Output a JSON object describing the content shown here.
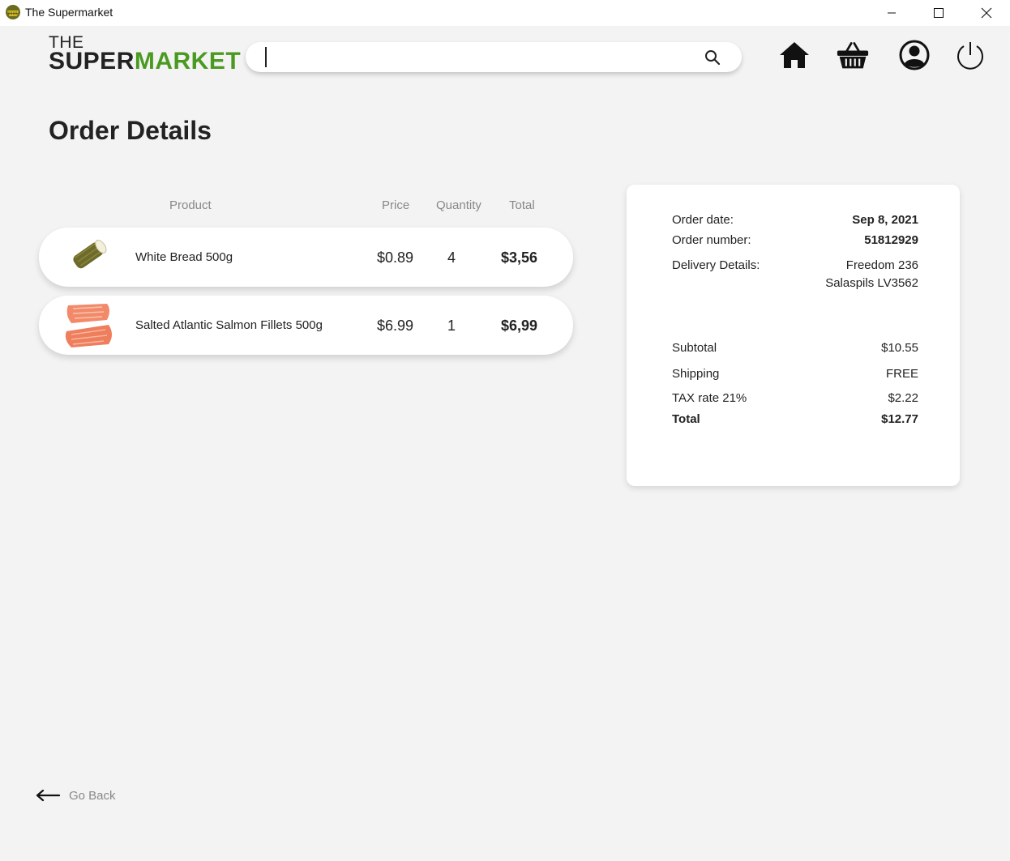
{
  "window": {
    "title": "The Supermarket",
    "icon": "basket-globe-icon"
  },
  "logo": {
    "the": "THE",
    "super": "SUPER",
    "market": "MARKET",
    "accent_color": "#4a9a21"
  },
  "search": {
    "value": "",
    "placeholder": ""
  },
  "nav": {
    "icons": [
      "home-icon",
      "basket-icon",
      "account-icon",
      "power-icon"
    ]
  },
  "page": {
    "title": "Order Details"
  },
  "table": {
    "headers": {
      "product": "Product",
      "price": "Price",
      "quantity": "Quantity",
      "total": "Total"
    },
    "items": [
      {
        "name": "White Bread 500g",
        "price": "$0.89",
        "quantity": "4",
        "total": "$3,56",
        "image": "bread-image"
      },
      {
        "name": "Salted Atlantic Salmon Fillets 500g",
        "price": "$6.99",
        "quantity": "1",
        "total": "$6,99",
        "image": "salmon-image"
      }
    ]
  },
  "summary": {
    "order_date_label": "Order date:",
    "order_date": "Sep 8, 2021",
    "order_number_label": "Order number:",
    "order_number": "51812929",
    "delivery_label": "Delivery Details:",
    "delivery_line1": "Freedom 236",
    "delivery_line2": "Salaspils LV3562",
    "subtotal_label": "Subtotal",
    "subtotal": "$10.55",
    "shipping_label": "Shipping",
    "shipping": "FREE",
    "tax_label": "TAX rate 21%",
    "tax": "$2.22",
    "total_label": "Total",
    "total": "$12.77"
  },
  "footer": {
    "back_label": "Go Back"
  }
}
